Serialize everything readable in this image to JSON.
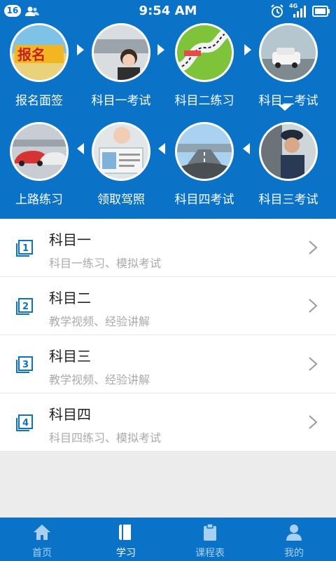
{
  "status_bar": {
    "badge": "16",
    "time": "9:54 AM",
    "network": "4G"
  },
  "flow": {
    "steps": [
      {
        "label": "报名面签",
        "icon": "registration-image"
      },
      {
        "label": "科目一考试",
        "icon": "exam-room-image"
      },
      {
        "label": "科目二练习",
        "icon": "course-map-image"
      },
      {
        "label": "科目二考试",
        "icon": "car-test-image"
      },
      {
        "label": "科目三考试",
        "icon": "officer-image"
      },
      {
        "label": "科目四考试",
        "icon": "road-view-image"
      },
      {
        "label": "领取驾照",
        "icon": "license-image"
      },
      {
        "label": "上路练习",
        "icon": "cars-image"
      }
    ]
  },
  "subjects": [
    {
      "badge": "1",
      "title": "科目一",
      "subtitle": "科目一练习、模拟考试"
    },
    {
      "badge": "2",
      "title": "科目二",
      "subtitle": "教学视频、经验讲解"
    },
    {
      "badge": "3",
      "title": "科目三",
      "subtitle": "教学视频、经验讲解"
    },
    {
      "badge": "4",
      "title": "科目四",
      "subtitle": "科目四练习、模拟考试"
    }
  ],
  "tabs": [
    {
      "label": "首页",
      "icon": "home-icon",
      "active": false
    },
    {
      "label": "学习",
      "icon": "book-icon",
      "active": true
    },
    {
      "label": "课程表",
      "icon": "clipboard-icon",
      "active": false
    },
    {
      "label": "我的",
      "icon": "user-icon",
      "active": false
    }
  ],
  "colors": {
    "primary": "#0a73c7",
    "background": "#ececec"
  }
}
